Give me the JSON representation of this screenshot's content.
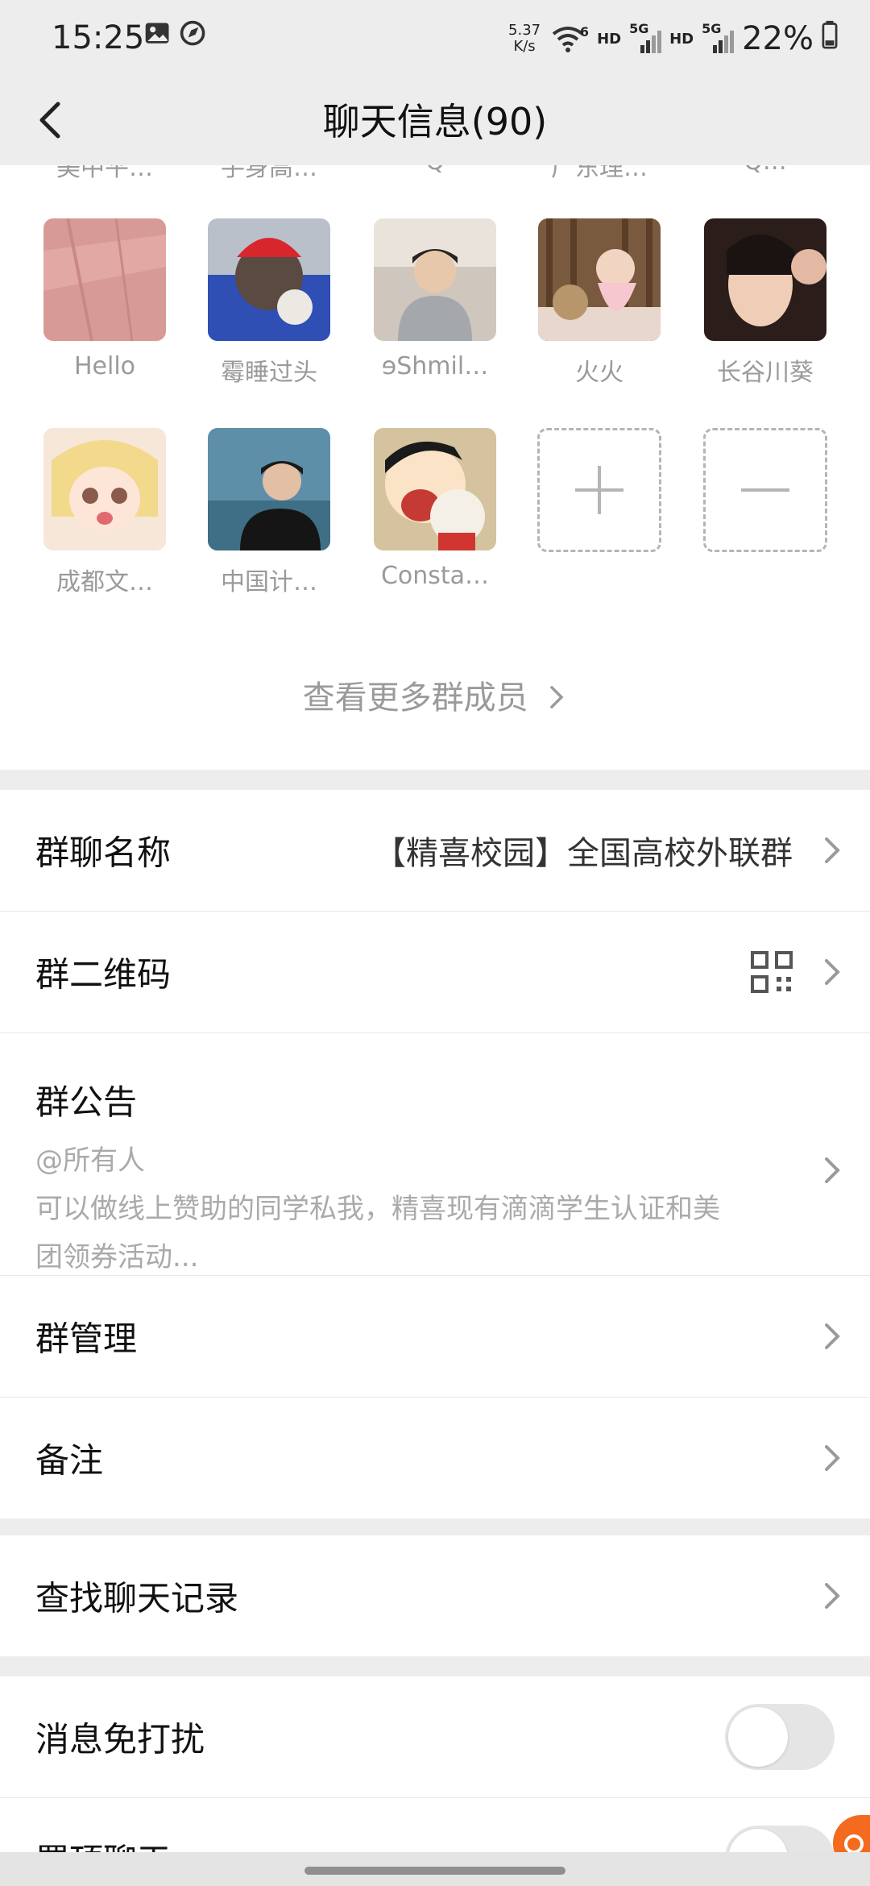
{
  "status_bar": {
    "time": "15:25",
    "net_speed_value": "5.37",
    "net_speed_unit": "K/s",
    "wifi_badge": "6",
    "hd1": "HD",
    "sig1": "5G",
    "hd2": "HD",
    "sig2": "5G",
    "battery": "22%"
  },
  "nav": {
    "title": "聊天信息(90)"
  },
  "members": {
    "cutoff_names": [
      "美中平…",
      "手身高…",
      "Q",
      "广东理…",
      "Q…"
    ],
    "row1": [
      {
        "name": "Hello",
        "icon": "avatar-pink-landscape"
      },
      {
        "name": "霉睡过头",
        "icon": "avatar-red-cap-person"
      },
      {
        "name": "ɘShmil…",
        "icon": "avatar-boy-gray-hoodie"
      },
      {
        "name": "火火",
        "icon": "avatar-girl-teddy-bear"
      },
      {
        "name": "长谷川葵",
        "icon": "avatar-girl-selfie"
      }
    ],
    "row2": [
      {
        "name": "成都文…",
        "icon": "avatar-anime-girl"
      },
      {
        "name": "中国计…",
        "icon": "avatar-man-dark-jacket"
      },
      {
        "name": "Consta…",
        "icon": "avatar-cartoon-boy-eating"
      }
    ],
    "add_icon": "plus-icon",
    "remove_icon": "minus-icon",
    "view_more": "查看更多群成员"
  },
  "settings": {
    "group_name_label": "群聊名称",
    "group_name_value": "【精喜校园】全国高校外联群",
    "qr_label": "群二维码",
    "notice_label": "群公告",
    "notice_line1": "@所有人",
    "notice_line2": "可以做线上赞助的同学私我，精喜现有滴滴学生认证和美",
    "notice_line3": "团领券活动...",
    "manage_label": "群管理",
    "remark_label": "备注",
    "search_history_label": "查找聊天记录",
    "mute_label": "消息免打扰",
    "pin_label": "置顶聊天",
    "mute_on": false,
    "pin_on": false
  },
  "colors": {
    "background": "#ededed",
    "card": "#ffffff",
    "accent_float": "#f46a1f"
  }
}
